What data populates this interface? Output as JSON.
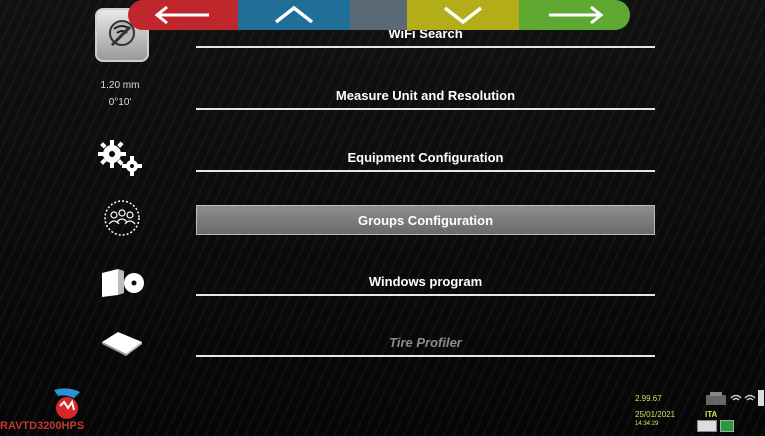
{
  "menu": {
    "items": [
      {
        "label": "WiFi Search"
      },
      {
        "label": "Measure Unit and Resolution"
      },
      {
        "label": "Equipment Configuration"
      },
      {
        "label": "Groups Configuration"
      },
      {
        "label": "Windows program"
      },
      {
        "label": "Tire Profiler"
      }
    ]
  },
  "measure": {
    "length": "1.20 mm",
    "angle": "0°10'"
  },
  "status": {
    "version": "2.99.67",
    "date": "25/01/2021",
    "time": "14:34:29",
    "language": "ITA"
  },
  "brand": {
    "name": "RAVTD3200HPS"
  },
  "colors": {
    "back": "#c0272d",
    "up": "#1f6f99",
    "middle": "#5a6a74",
    "down": "#b3ad1a",
    "next": "#5fa832",
    "status_text": "#c8e85a"
  },
  "icons": [
    "wifi-search-icon",
    "gears-icon",
    "groups-icon",
    "windows-program-icon",
    "tire-profiler-icon",
    "back-arrow-icon",
    "up-arrow-icon",
    "down-arrow-icon",
    "next-arrow-icon",
    "keyboard-icon",
    "wifi-status-icon"
  ]
}
